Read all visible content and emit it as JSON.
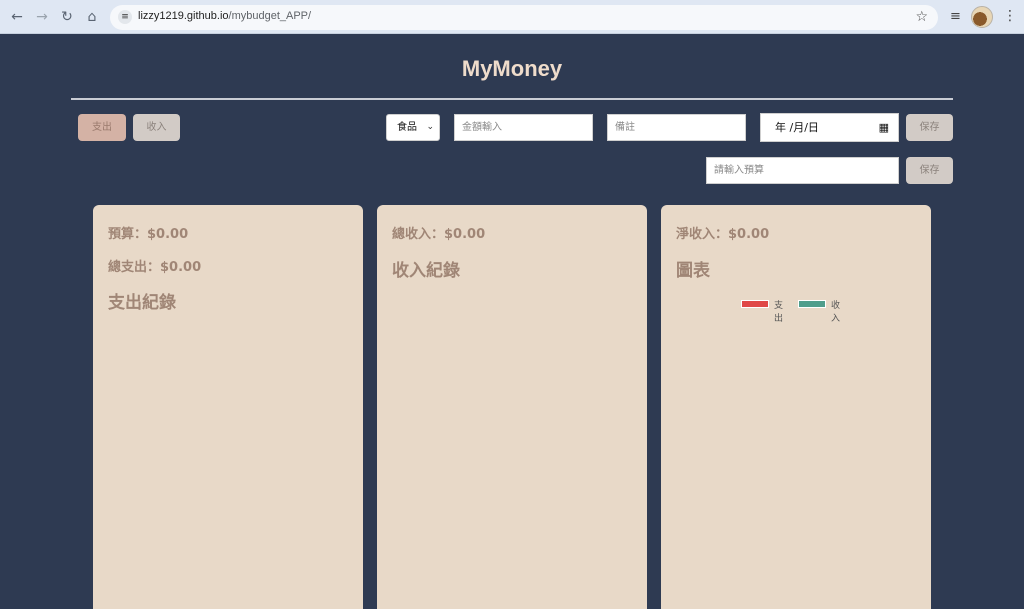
{
  "browser": {
    "url_host": "lizzy1219.github.io",
    "url_path": "/mybudget_APP/"
  },
  "app": {
    "title": "MyMoney"
  },
  "toolbar": {
    "expense_tab_label": "支出",
    "income_tab_label": "收入",
    "category_selected": "食品",
    "amount_placeholder": "金額輸入",
    "note_placeholder": "備註",
    "date_placeholder": "年 /月/日",
    "save_label": "保存",
    "budget_placeholder": "請輸入預算",
    "budget_save_label": "保存"
  },
  "cards": {
    "expense": {
      "budget": "預算：$0.00",
      "total_expense": "總支出：$0.00",
      "heading": "支出紀錄"
    },
    "income": {
      "total_income": "總收入：$0.00",
      "heading": "收入紀錄"
    },
    "chart": {
      "net_income": "淨收入：$0.00",
      "heading": "圖表",
      "legend": [
        {
          "label": "支出",
          "color": "#e04848"
        },
        {
          "label": "收入",
          "color": "#4f9e8c"
        }
      ]
    }
  },
  "colors": {
    "page_background": "#2e3a52",
    "card_background": "#e8d9c8",
    "title_color": "#efdccb"
  }
}
